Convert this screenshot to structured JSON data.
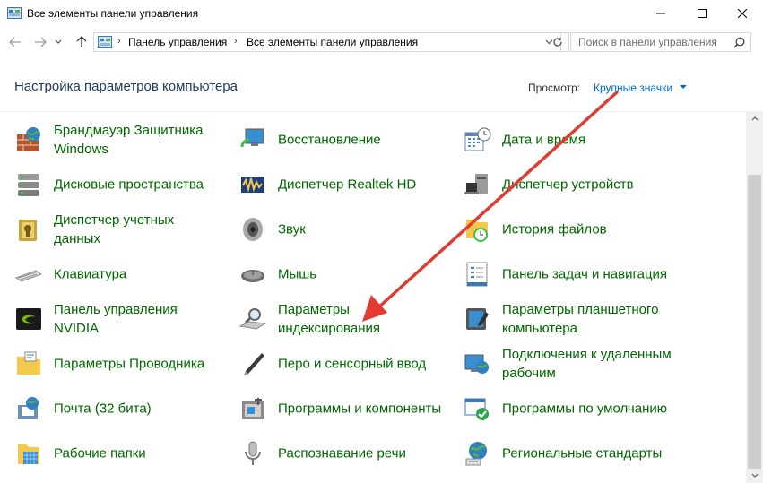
{
  "window": {
    "title": "Все элементы панели управления",
    "controls": {
      "minimize": "minimize-icon",
      "maximize": "maximize-icon",
      "close": "close-icon"
    }
  },
  "nav": {
    "back_icon": "arrow-left-icon",
    "forward_icon": "arrow-right-icon",
    "up_icon": "arrow-up-icon",
    "breadcrumb": [
      "Панель управления",
      "Все элементы панели управления"
    ],
    "search_placeholder": "Поиск в панели управления"
  },
  "header": {
    "title": "Настройка параметров компьютера",
    "view_label": "Просмотр:",
    "view_value": "Крупные значки"
  },
  "colors": {
    "link_green": "#006600",
    "accent_blue": "#0066cc",
    "title_blue": "#1e395b",
    "annotation_red": "#e03c31"
  },
  "items": [
    [
      {
        "label": "Брандмауэр Защитника Windows",
        "icon": "firewall-icon"
      },
      {
        "label": "Дисковые пространства",
        "icon": "storage-spaces-icon"
      },
      {
        "label": "Диспетчер учетных данных",
        "icon": "credential-manager-icon"
      },
      {
        "label": "Клавиатура",
        "icon": "keyboard-icon"
      },
      {
        "label": "Панель управления NVIDIA",
        "icon": "nvidia-icon"
      },
      {
        "label": "Параметры Проводника",
        "icon": "folder-options-icon"
      },
      {
        "label": "Почта (32 бита)",
        "icon": "mail-icon"
      },
      {
        "label": "Рабочие папки",
        "icon": "work-folders-icon"
      }
    ],
    [
      {
        "label": "Восстановление",
        "icon": "recovery-icon"
      },
      {
        "label": "Диспетчер Realtek HD",
        "icon": "realtek-icon"
      },
      {
        "label": "Звук",
        "icon": "speaker-icon"
      },
      {
        "label": "Мышь",
        "icon": "mouse-icon"
      },
      {
        "label": "Параметры индексирования",
        "icon": "indexing-icon"
      },
      {
        "label": "Перо и сенсорный ввод",
        "icon": "pen-icon"
      },
      {
        "label": "Программы и компоненты",
        "icon": "programs-icon"
      },
      {
        "label": "Распознавание речи",
        "icon": "microphone-icon"
      }
    ],
    [
      {
        "label": "Дата и время",
        "icon": "calendar-clock-icon"
      },
      {
        "label": "Диспетчер устройств",
        "icon": "device-manager-icon"
      },
      {
        "label": "История файлов",
        "icon": "file-history-icon"
      },
      {
        "label": "Панель задач и навигация",
        "icon": "taskbar-icon"
      },
      {
        "label": "Параметры планшетного компьютера",
        "icon": "tablet-icon"
      },
      {
        "label": "Подключения к удаленным рабочим",
        "icon": "remote-desktop-icon"
      },
      {
        "label": "Программы по умолчанию",
        "icon": "default-programs-icon"
      },
      {
        "label": "Региональные стандарты",
        "icon": "globe-icon"
      }
    ]
  ]
}
